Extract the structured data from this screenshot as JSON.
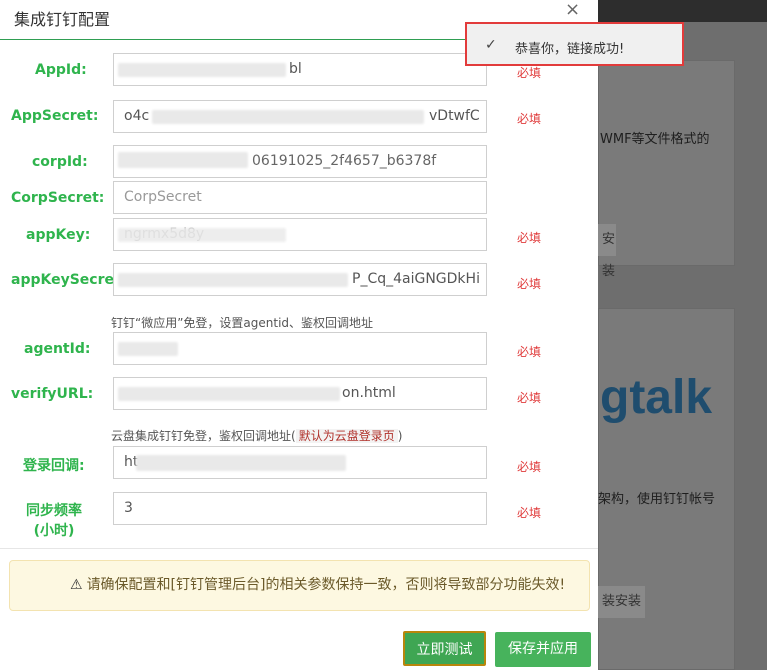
{
  "background": {
    "text_wmf": "WMF等文件格式的",
    "text_arch": "架构，使用钉钉帐号",
    "logo_partial": "gtalk",
    "btn_install": "安装",
    "btn_install2": "装安装"
  },
  "modal": {
    "title": "集成钉钉配置",
    "close_glyph": "×",
    "required_label": "必填"
  },
  "fields": {
    "appid": {
      "label": "AppId:",
      "value_tail": "bl"
    },
    "appsecret": {
      "label": "AppSecret:",
      "value_head": "o4c",
      "value_tail": "vDtwfC"
    },
    "corpid": {
      "label": "corpId:",
      "value_tail": "06191025_2f4657_b6378f"
    },
    "corpsecret": {
      "label": "CorpSecret:",
      "placeholder": "CorpSecret"
    },
    "appkey": {
      "label": "appKey:",
      "value_tail": "ngrmx5d8y"
    },
    "appkeysecret": {
      "label": "appKeySecret:",
      "value_tail": "P_Cq_4aiGNGDkHi"
    },
    "agentid": {
      "label": "agentId:"
    },
    "verifyurl": {
      "label": "verifyURL:",
      "value_tail": "on.html"
    },
    "login_callback": {
      "label": "登录回调:",
      "value_head": "ht"
    },
    "sync_rate": {
      "label_line1": "同步频率",
      "label_line2": "(小时)",
      "value": "3"
    }
  },
  "hints": {
    "agent_hint": "钉钉“微应用”免登，设置agentid、鉴权回调地址",
    "login_hint_prefix": "云盘集成钉钉免登，鉴权回调地址(",
    "login_hint_link": "默认为云盘登录页",
    "login_hint_suffix": ")"
  },
  "warning": {
    "icon": "⚠",
    "text": "请确保配置和[钉钉管理后台]的相关参数保持一致，否则将导致部分功能失效!"
  },
  "buttons": {
    "test": "立即测试",
    "save": "保存并应用"
  },
  "toast": {
    "check": "✓",
    "message": "恭喜你，链接成功!"
  },
  "colors": {
    "accent_green": "#2fb44d",
    "required_red": "#e03c3c",
    "toast_border": "#e23b3b"
  }
}
